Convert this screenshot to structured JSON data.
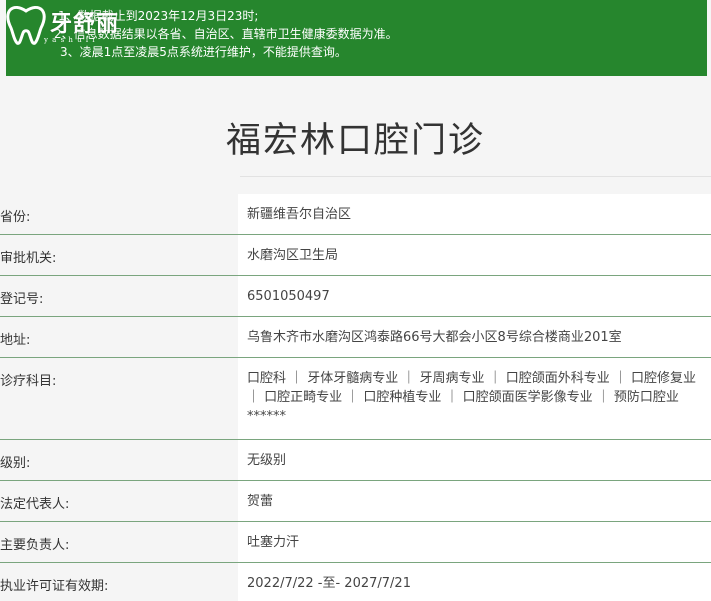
{
  "notice": {
    "lines": [
      "1、数据截止到2023年12月3日23时;",
      "2、信息数据结果以各省、自治区、直辖市卫生健康委数据为准。",
      "3、凌晨1点至凌晨5点系统进行维护，不能提供查询。"
    ]
  },
  "logo": {
    "brand": "牙舒丽",
    "sub": "y a s h u l i"
  },
  "clinic": {
    "name": "福宏林口腔门诊"
  },
  "fields": [
    {
      "label": "省份:",
      "value": "新疆维吾尔自治区"
    },
    {
      "label": "审批机关:",
      "value": "水磨沟区卫生局"
    },
    {
      "label": "登记号:",
      "value": "6501050497"
    },
    {
      "label": "地址:",
      "value": "乌鲁木齐市水磨沟区鸿泰路66号大都会小区8号综合楼商业201室"
    },
    {
      "label": "诊疗科目:",
      "value": "口腔科 ｜ 牙体牙髓病专业 ｜ 牙周病专业 ｜ 口腔颌面外科专业 ｜ 口腔修复业 ｜ 口腔正畸专业 ｜ 口腔种植专业 ｜ 口腔颌面医学影像专业 ｜ 预防口腔业******"
    },
    {
      "label": "级别:",
      "value": "无级别"
    },
    {
      "label": "法定代表人:",
      "value": "贺蕾"
    },
    {
      "label": "主要负责人:",
      "value": "吐塞力汗"
    },
    {
      "label": "执业许可证有效期:",
      "value": "2022/7/22 -至- 2027/7/21"
    }
  ]
}
